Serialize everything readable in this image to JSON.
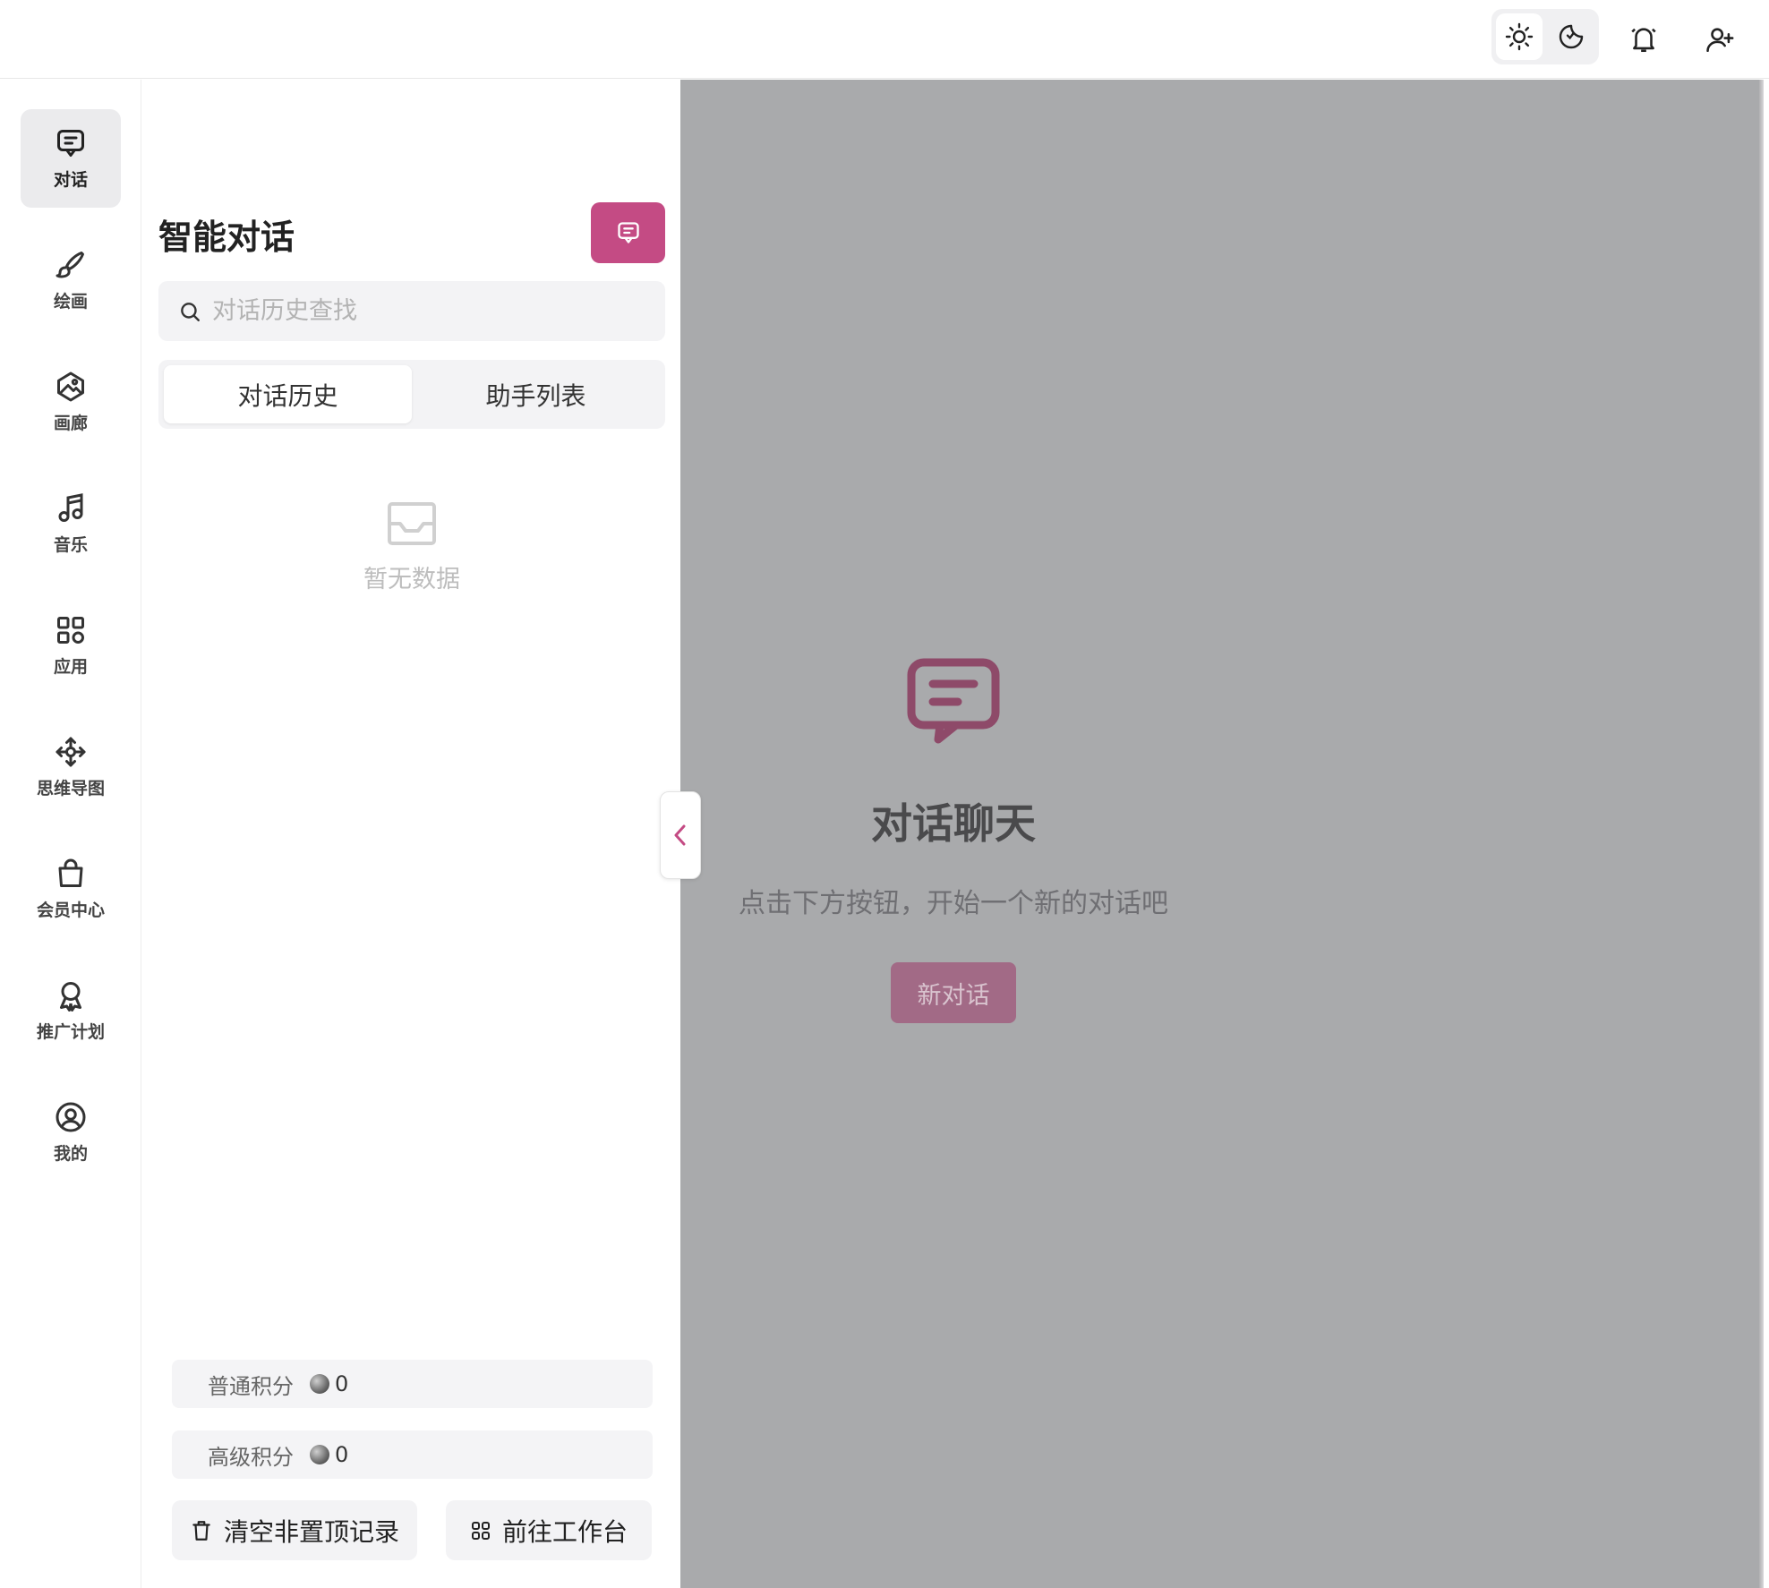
{
  "header": {
    "theme_light_icon": "sun-icon",
    "theme_dark_icon": "moon-icon",
    "notification_icon": "bell-icon",
    "user_icon": "user-plus-icon"
  },
  "nav": {
    "items": [
      {
        "label": "对话",
        "icon": "chat-icon",
        "active": true
      },
      {
        "label": "绘画",
        "icon": "brush-icon"
      },
      {
        "label": "画廊",
        "icon": "gallery-icon"
      },
      {
        "label": "音乐",
        "icon": "music-icon"
      },
      {
        "label": "应用",
        "icon": "apps-icon"
      },
      {
        "label": "思维导图",
        "icon": "mindmap-icon"
      },
      {
        "label": "会员中心",
        "icon": "bag-icon"
      },
      {
        "label": "推广计划",
        "icon": "award-icon"
      },
      {
        "label": "我的",
        "icon": "user-circle-icon"
      }
    ]
  },
  "panel": {
    "title": "智能对话",
    "search_placeholder": "对话历史查找",
    "tabs": [
      "对话历史",
      "助手列表"
    ],
    "active_tab": 0,
    "empty_text": "暂无数据",
    "points": [
      {
        "label": "普通积分",
        "value": "0"
      },
      {
        "label": "高级积分",
        "value": "0"
      }
    ],
    "clear_button": "清空非置顶记录",
    "workspace_button": "前往工作台"
  },
  "main": {
    "title": "对话聊天",
    "subtitle": "点击下方按钮，开始一个新的对话吧",
    "new_chat_button": "新对话"
  },
  "colors": {
    "accent": "#c44b84",
    "overlay": "#a9aaac"
  }
}
